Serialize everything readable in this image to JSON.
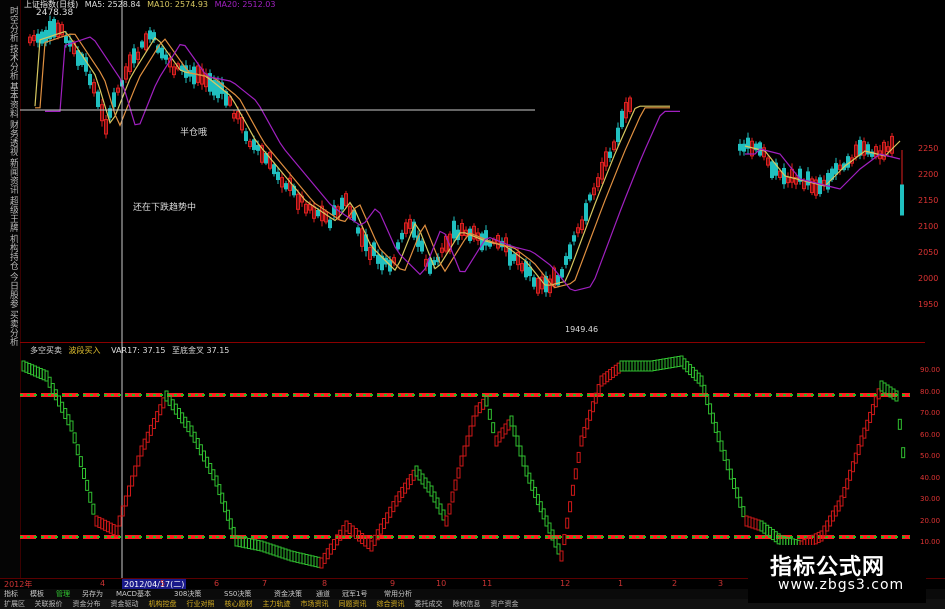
{
  "colors": {
    "up": "#e02020",
    "down": "#20c0c0",
    "ma_yellow": "#d8c860",
    "ma_orange": "#e09040",
    "ma_purple": "#a020c0",
    "ind_red": "#d01818",
    "ind_green": "#30c030",
    "guide_red": "#ff2020",
    "guide_green": "#20c020"
  },
  "sidebar": {
    "items": [
      "时空分析",
      "技术分析",
      "基本资料",
      "财务透视",
      "新闻资讯",
      "超级王牌",
      "机构持仓",
      "今日股参",
      "买卖分析"
    ]
  },
  "main_title": {
    "name": "上证指数(日线)",
    "ma5": "MA5: 2528.84",
    "ma10": "MA10: 2574.93",
    "ma20": "MA20: 2512.03"
  },
  "annotations": {
    "high_price": "2478.38",
    "half_position": "半仓哦",
    "downtrend": "还在下跌趋势中",
    "low_price": "1949.46"
  },
  "right_axis_main": [
    "2250",
    "2200",
    "2150",
    "2100",
    "2050",
    "2000",
    "1950"
  ],
  "right_axis_ind": [
    "90.00",
    "80.00",
    "70.00",
    "60.00",
    "50.00",
    "40.00",
    "30.00",
    "20.00",
    "10.00"
  ],
  "indicator": {
    "name": "多空买卖",
    "buy_label": "波段买入",
    "var_label": "VAR17: 37.15",
    "ref_label": "至底金叉 37.15"
  },
  "timeline": {
    "ticks": [
      "2012年",
      "4",
      "5",
      "6",
      "7",
      "8",
      "9",
      "10",
      "11",
      "12",
      "1",
      "2",
      "3"
    ],
    "current_date": "2012/04/17(二)"
  },
  "tabs": {
    "items": [
      "指标",
      "模板",
      "管理",
      "另存为",
      "MACD基本",
      "308决策",
      "SS0决策",
      "资金决策",
      "通道",
      "冠军1号",
      "常用分析"
    ],
    "active_index": 2
  },
  "bottom_tabs": {
    "items": [
      "扩展区",
      "关联报价",
      "资金分布",
      "资金驱动",
      "机构控盘",
      "行业对照",
      "核心题材",
      "主力轨迹",
      "市场资讯",
      "同题资讯",
      "综合资讯",
      "委托成交",
      "除权信息",
      "资产资金"
    ],
    "highlight": [
      4,
      5,
      6,
      7,
      8,
      9,
      10
    ]
  },
  "watermark": {
    "cn": "指标公式网",
    "url": "www.zbgs3.com"
  }
}
